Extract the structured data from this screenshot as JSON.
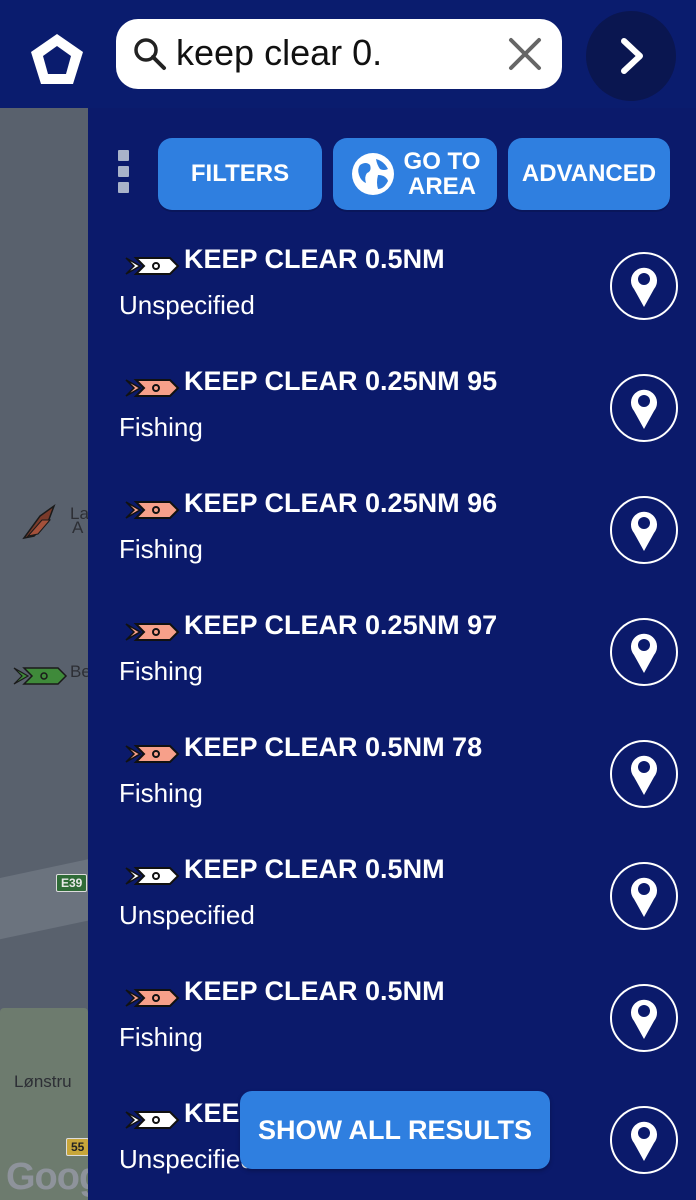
{
  "search": {
    "value": "keep clear 0.",
    "placeholder": ""
  },
  "toolbar": {
    "filters_label": "FILTERS",
    "goto_line1": "GO TO",
    "goto_line2": "AREA",
    "advanced_label": "ADVANCED"
  },
  "results": [
    {
      "title": "KEEP CLEAR 0.5NM",
      "type": "Unspecified",
      "icon_color": "#ffffff"
    },
    {
      "title": "KEEP CLEAR 0.25NM 95",
      "type": "Fishing",
      "icon_color": "#f7a08a"
    },
    {
      "title": "KEEP CLEAR 0.25NM 96",
      "type": "Fishing",
      "icon_color": "#f7a08a"
    },
    {
      "title": "KEEP CLEAR 0.25NM 97",
      "type": "Fishing",
      "icon_color": "#f7a08a"
    },
    {
      "title": "KEEP CLEAR 0.5NM 78",
      "type": "Fishing",
      "icon_color": "#f7a08a"
    },
    {
      "title": "KEEP CLEAR 0.5NM",
      "type": "Unspecified",
      "icon_color": "#ffffff"
    },
    {
      "title": "KEEP CLEAR 0.5NM",
      "type": "Fishing",
      "icon_color": "#f7a08a"
    },
    {
      "title": "KEEP CLEAR 0.5NM",
      "type": "Unspecified",
      "icon_color": "#ffffff"
    }
  ],
  "show_all_label": "SHOW ALL RESULTS",
  "map": {
    "labels": [
      "La",
      "A",
      "Be",
      "E39",
      "Lønstru",
      "55",
      "Goog"
    ]
  },
  "colors": {
    "topbar": "#0a1c6e",
    "panel": "#0b1a6b",
    "button": "#2f7fe0",
    "fishing_icon": "#f7a08a",
    "unspecified_icon": "#ffffff"
  },
  "icons": {
    "home": "pentagon-home-icon",
    "search": "search-icon",
    "clear": "close-icon",
    "next": "chevron-right-icon",
    "menu": "kebab-menu-icon",
    "globe": "globe-icon",
    "vessel": "vessel-icon",
    "locate": "map-pin-icon"
  }
}
